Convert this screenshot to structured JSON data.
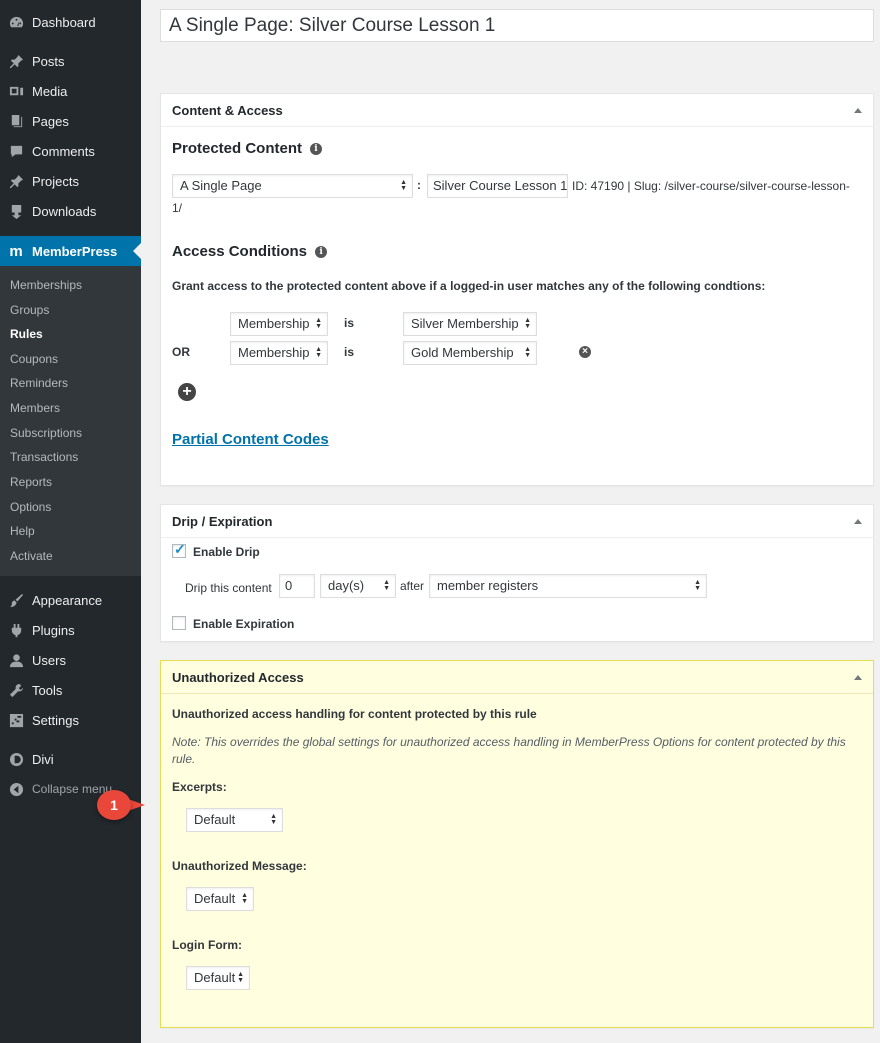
{
  "sidebar": {
    "items": [
      {
        "label": "Dashboard",
        "icon": "dashboard-icon"
      },
      {
        "label": "Posts",
        "icon": "pin-icon"
      },
      {
        "label": "Media",
        "icon": "media-icon"
      },
      {
        "label": "Pages",
        "icon": "pages-icon"
      },
      {
        "label": "Comments",
        "icon": "comment-icon"
      },
      {
        "label": "Projects",
        "icon": "pin-icon"
      },
      {
        "label": "Downloads",
        "icon": "download-icon"
      },
      {
        "label": "MemberPress",
        "icon": "memberpress-icon"
      },
      {
        "label": "Appearance",
        "icon": "brush-icon"
      },
      {
        "label": "Plugins",
        "icon": "plugin-icon"
      },
      {
        "label": "Users",
        "icon": "user-icon"
      },
      {
        "label": "Tools",
        "icon": "wrench-icon"
      },
      {
        "label": "Settings",
        "icon": "settings-icon"
      },
      {
        "label": "Divi",
        "icon": "divi-icon"
      }
    ],
    "submenu": [
      "Memberships",
      "Groups",
      "Rules",
      "Coupons",
      "Reminders",
      "Members",
      "Subscriptions",
      "Transactions",
      "Reports",
      "Options",
      "Help",
      "Activate"
    ],
    "current_submenu": "Rules",
    "collapse_label": "Collapse menu"
  },
  "title": "A Single Page: Silver Course Lesson 1",
  "content_access": {
    "heading": "Content & Access",
    "protected_content": "Protected Content",
    "content_type": "A Single Page",
    "colon": ":",
    "content_value": "Silver Course Lesson 1",
    "content_meta_line1": "ID: 47190 | Slug: /silver-course/silver-course-lesson-",
    "content_meta_line2": "1/",
    "access_conditions": "Access Conditions",
    "grant_text": "Grant access to the protected content above if a logged-in user matches any of the following condtions:",
    "conditions": [
      {
        "prefix": "",
        "type": "Membership",
        "op": "is",
        "value": "Silver Membership"
      },
      {
        "prefix": "OR",
        "type": "Membership",
        "op": "is",
        "value": "Gold Membership"
      }
    ],
    "partial_link": "Partial Content Codes"
  },
  "drip": {
    "heading": "Drip / Expiration",
    "enable_drip": "Enable Drip",
    "enable_drip_checked": true,
    "drip_label": "Drip this content",
    "drip_value": "0",
    "drip_unit": "day(s)",
    "after_label": "after",
    "after_value": "member registers",
    "enable_expiration": "Enable Expiration",
    "enable_expiration_checked": false
  },
  "unauthorized": {
    "heading": "Unauthorized Access",
    "subheading": "Unauthorized access handling for content protected by this rule",
    "note": "Note: This overrides the global settings for unauthorized access handling in MemberPress Options for content protected by this rule.",
    "excerpts_label": "Excerpts:",
    "excerpts_value": "Default",
    "message_label": "Unauthorized Message:",
    "message_value": "Default",
    "login_label": "Login Form:",
    "login_value": "Default"
  },
  "callout": "1",
  "colors": {
    "sidebar_bg": "#23282d",
    "submenu_bg": "#32373c",
    "accent": "#0073aa",
    "callout": "#e8473a",
    "highlight_panel": "#ffffe0"
  }
}
